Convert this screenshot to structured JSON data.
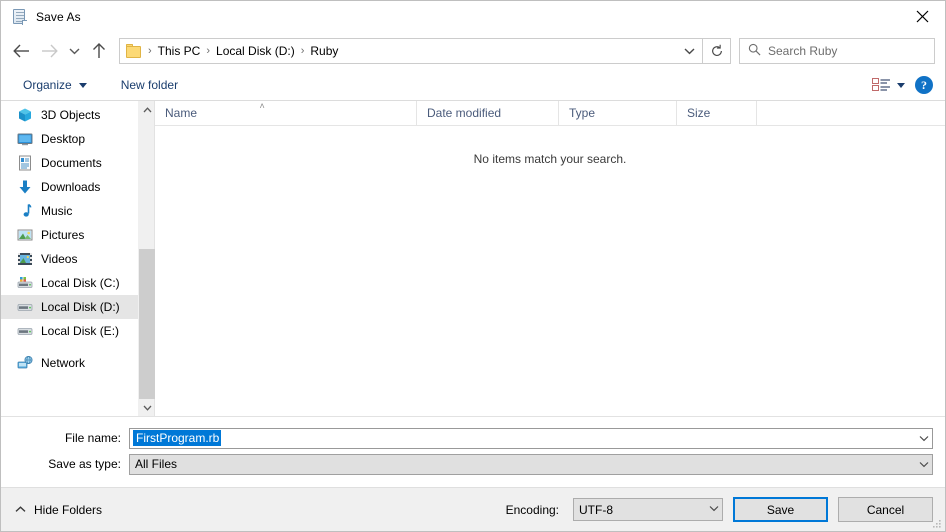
{
  "window": {
    "title": "Save As",
    "title_icon": "notepad-icon",
    "close_icon": "close-icon"
  },
  "nav": {
    "back_icon": "back-arrow-icon",
    "forward_icon": "forward-arrow-icon",
    "recent_icon": "chevron-down-icon",
    "up_icon": "up-arrow-icon",
    "breadcrumb": [
      "This PC",
      "Local Disk (D:)",
      "Ruby"
    ],
    "breadcrumb_separator": "›",
    "address_dropdown_icon": "chevron-down-icon",
    "refresh_icon": "refresh-icon"
  },
  "search": {
    "placeholder": "Search Ruby",
    "icon": "search-icon"
  },
  "toolbar": {
    "organize_label": "Organize",
    "new_folder_label": "New folder",
    "view_icon": "list-view-icon",
    "view_dropdown_icon": "chevron-down-icon",
    "help_label": "?",
    "help_icon": "help-icon"
  },
  "sidebar": {
    "items": [
      {
        "label": "3D Objects",
        "icon": "3d-objects-icon",
        "selected": false
      },
      {
        "label": "Desktop",
        "icon": "desktop-icon",
        "selected": false
      },
      {
        "label": "Documents",
        "icon": "documents-icon",
        "selected": false
      },
      {
        "label": "Downloads",
        "icon": "downloads-icon",
        "selected": false
      },
      {
        "label": "Music",
        "icon": "music-icon",
        "selected": false
      },
      {
        "label": "Pictures",
        "icon": "pictures-icon",
        "selected": false
      },
      {
        "label": "Videos",
        "icon": "videos-icon",
        "selected": false
      },
      {
        "label": "Local Disk (C:)",
        "icon": "system-drive-icon",
        "selected": false
      },
      {
        "label": "Local Disk (D:)",
        "icon": "drive-icon",
        "selected": true
      },
      {
        "label": "Local Disk (E:)",
        "icon": "drive-icon",
        "selected": false
      },
      {
        "label": "Network",
        "icon": "network-icon",
        "selected": false
      }
    ]
  },
  "filelist": {
    "columns": [
      "Name",
      "Date modified",
      "Type",
      "Size"
    ],
    "sort_column": "Name",
    "sort_caret": "˄",
    "rows": [],
    "empty_message": "No items match your search."
  },
  "form": {
    "file_name_label": "File name:",
    "file_name_value": "FirstProgram.rb",
    "file_name_selected": true,
    "save_as_type_label": "Save as type:",
    "save_as_type_value": "All Files"
  },
  "footer": {
    "hide_folders_label": "Hide Folders",
    "hide_folders_icon": "chevron-up-icon",
    "encoding_label": "Encoding:",
    "encoding_value": "UTF-8",
    "save_label": "Save",
    "cancel_label": "Cancel"
  },
  "colors": {
    "accent": "#0078d7",
    "selection": "#0078d7",
    "sidebar_selected": "#e5e5e5",
    "footer_bg": "#f0f0f0",
    "button_bg": "#e1e1e1",
    "column_header_text": "#4a5b7b",
    "link_text": "#1a3d6d"
  }
}
